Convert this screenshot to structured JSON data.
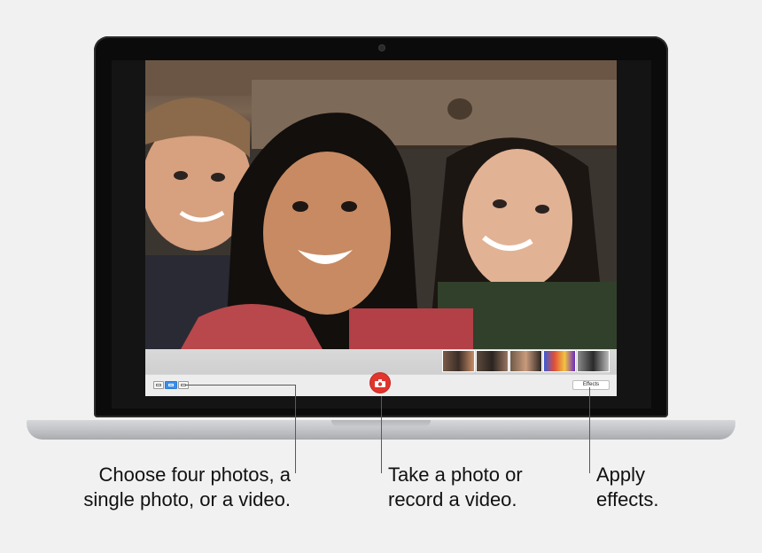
{
  "app": {
    "effects_label": "Effects",
    "icons": {
      "shutter": "camera-icon",
      "mode_four": "four-photos-icon",
      "mode_single": "single-photo-icon",
      "mode_video": "video-icon"
    },
    "accent_color": "#3b8ee8",
    "shutter_color": "#e0342c"
  },
  "callouts": {
    "left": [
      "Choose four photos, a",
      "single photo, or a video."
    ],
    "center": [
      "Take a photo or",
      "record a video."
    ],
    "right": [
      "Apply",
      "effects."
    ]
  }
}
